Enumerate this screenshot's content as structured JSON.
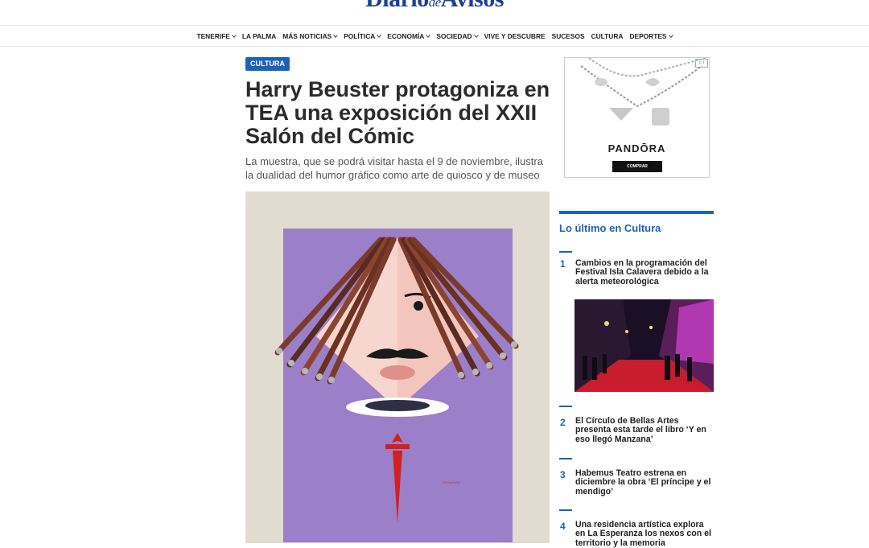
{
  "header": {
    "logo_part1": "Diario",
    "logo_part2": "de",
    "logo_part3": "Avisos"
  },
  "nav": {
    "items": [
      {
        "label": "TENERIFE",
        "dropdown": true
      },
      {
        "label": "LA PALMA",
        "dropdown": false
      },
      {
        "label": "MÁS NOTICIAS",
        "dropdown": true
      },
      {
        "label": "POLÍTICA",
        "dropdown": true
      },
      {
        "label": "ECONOMÍA",
        "dropdown": true
      },
      {
        "label": "SOCIEDAD",
        "dropdown": true
      },
      {
        "label": "VIVE Y DESCUBRE",
        "dropdown": false
      },
      {
        "label": "SUCESOS",
        "dropdown": false
      },
      {
        "label": "CULTURA",
        "dropdown": false
      },
      {
        "label": "DEPORTES",
        "dropdown": true
      }
    ]
  },
  "article": {
    "tag": "CULTURA",
    "headline": "Harry Beuster protagoniza en TEA una exposición del XXII Salón del Cómic",
    "subtitle": "La muestra, que se podrá visitar hasta el 9 de noviembre, ilustra la dualidad del humor gráfico como arte de quiosco y de museo"
  },
  "ad": {
    "brand": "PANDŌRA",
    "button": "COMPRAR"
  },
  "sidebar": {
    "title": "Lo último en Cultura",
    "items": [
      {
        "num": "1",
        "text": "Cambios en la programación del Festival Isla Calavera debido a la alerta meteorológica"
      },
      {
        "num": "2",
        "text": "El Círculo de Bellas Artes presenta esta tarde el libro ‘Y en eso llegó Manzana’"
      },
      {
        "num": "3",
        "text": "Habemus Teatro estrena en diciembre la obra ‘El príncipe y el mendigo’"
      },
      {
        "num": "4",
        "text": "Una residencia artística explora en La Esperanza los nexos con el territorio y la memoria"
      }
    ]
  },
  "colors": {
    "accent": "#1c63b6",
    "logo": "#1f3f8f",
    "painting_bg": "#9b7fc9"
  }
}
